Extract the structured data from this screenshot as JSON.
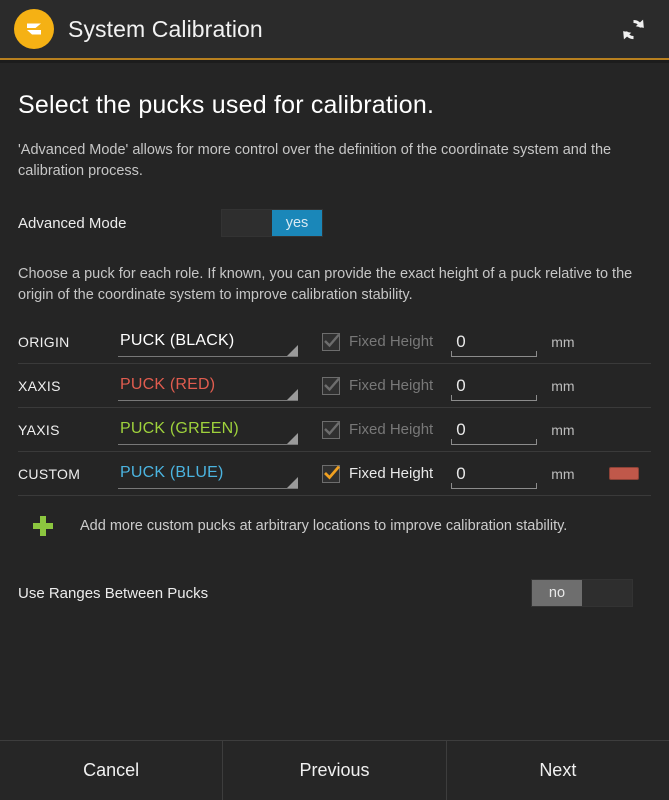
{
  "header": {
    "title": "System Calibration",
    "logo_icon": "z-logo-icon",
    "refresh_icon": "refresh-icon",
    "accent_color": "#b8801f",
    "logo_color": "#f5b114"
  },
  "page": {
    "title": "Select the pucks used for calibration.",
    "description": "'Advanced Mode' allows for more control over the definition of the coordinate system and the calibration process.",
    "hint": "Choose a puck for each role. If known, you can provide the exact height of a puck relative to the origin of the coordinate system to improve calibration stability."
  },
  "advanced_mode": {
    "label": "Advanced Mode",
    "value": "yes",
    "state": "on",
    "on_color": "#1a87b9"
  },
  "pucks": {
    "columns": [
      "role",
      "puck",
      "fixed_height",
      "value",
      "unit"
    ],
    "rows": [
      {
        "role": "ORIGIN",
        "puck": "PUCK (BLACK)",
        "puck_color": "#ffffff",
        "fixed_height_label": "Fixed Height",
        "checked": true,
        "enabled": false,
        "value": "0",
        "unit": "mm",
        "removable": false
      },
      {
        "role": "XAXIS",
        "puck": "PUCK (RED)",
        "puck_color": "#e05c4f",
        "fixed_height_label": "Fixed Height",
        "checked": true,
        "enabled": false,
        "value": "0",
        "unit": "mm",
        "removable": false
      },
      {
        "role": "YAXIS",
        "puck": "PUCK (GREEN)",
        "puck_color": "#9fd23c",
        "fixed_height_label": "Fixed Height",
        "checked": true,
        "enabled": false,
        "value": "0",
        "unit": "mm",
        "removable": false
      },
      {
        "role": "CUSTOM",
        "puck": "PUCK (BLUE)",
        "puck_color": "#4bb4e0",
        "fixed_height_label": "Fixed Height",
        "checked": true,
        "enabled": true,
        "value": "0",
        "unit": "mm",
        "removable": true
      }
    ]
  },
  "add_more": {
    "icon": "plus-icon",
    "icon_color": "#8cc63f",
    "text": "Add more custom pucks at arbitrary locations to improve calibration stability."
  },
  "use_ranges": {
    "label": "Use Ranges Between Pucks",
    "value": "no",
    "state": "off"
  },
  "footer": {
    "cancel": "Cancel",
    "previous": "Previous",
    "next": "Next"
  }
}
